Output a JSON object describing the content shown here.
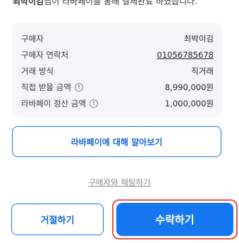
{
  "notice": {
    "bold": "최박이김",
    "text": "님이 라바페이를 통해 결제완료 하였습니다."
  },
  "info": {
    "rows": [
      {
        "label": "구매자",
        "value": "최박이김"
      },
      {
        "label": "구매자 연락처",
        "value": "01056785678"
      },
      {
        "label": "거래 방식",
        "value": "직거래"
      },
      {
        "label": "직접 받을 금액",
        "value": "8,990,000원"
      },
      {
        "label": "라바페이 정산 금액",
        "value": "1,000,000원"
      }
    ]
  },
  "buttons": {
    "learn": "라바페이에 대해 알아보기",
    "chat": "구매자와 채팅하기",
    "reject": "거절하기",
    "accept": "수락하기"
  },
  "icons": {
    "info": "info-icon"
  },
  "colors": {
    "primary": "#1677f2",
    "highlight": "#e0554f",
    "card_bg": "#f5f6f8"
  }
}
